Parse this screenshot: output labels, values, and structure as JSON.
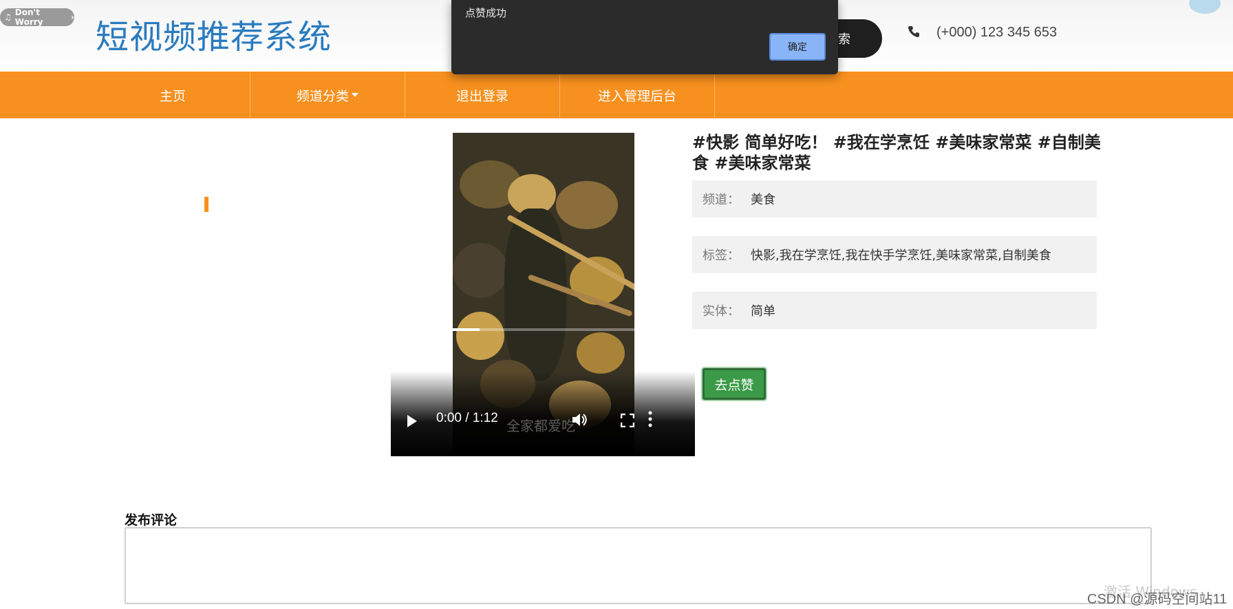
{
  "header": {
    "site_title": "短视频推荐系统",
    "music_label": "Don't Worry",
    "search_label": "索",
    "phone": "(+000) 123 345 653"
  },
  "nav": {
    "items": [
      {
        "label": "主页"
      },
      {
        "label": "频道分类"
      },
      {
        "label": "退出登录"
      },
      {
        "label": "进入管理后台"
      }
    ]
  },
  "alert": {
    "message": "点赞成功",
    "ok_label": "确定"
  },
  "video": {
    "time": "0:00 / 1:12",
    "progress": 0.27,
    "overlay_text": "全家都爱吃"
  },
  "detail": {
    "title": "#快影 简单好吃！ #我在学烹饪 #美味家常菜 #自制美食 #美味家常菜",
    "rows": [
      {
        "key": "频道：",
        "value": "美食"
      },
      {
        "key": "标签：",
        "value": "快影,我在学烹饪,我在快手学烹饪,美味家常菜,自制美食"
      },
      {
        "key": "实体：",
        "value": "简单"
      }
    ],
    "like_label": "去点赞"
  },
  "comment": {
    "label": "发布评论",
    "value": ""
  },
  "watermark": {
    "windows": "激活 Windows",
    "csdn": "CSDN @源码空间站11"
  },
  "colors": {
    "nav_bg": "#f7901e",
    "title_blue": "#2a7bbf",
    "like_green": "#3b9a48",
    "alert_bg": "#2b2b2b"
  }
}
